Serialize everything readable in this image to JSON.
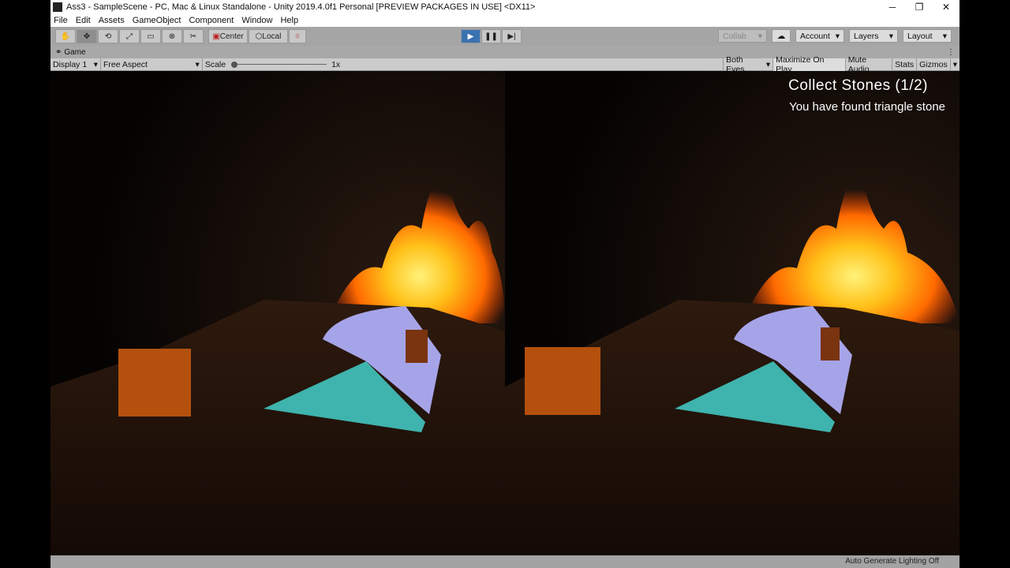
{
  "title": "Ass3 - SampleScene - PC, Mac & Linux Standalone - Unity 2019.4.0f1 Personal [PREVIEW PACKAGES IN USE] <DX11>",
  "menu": [
    "File",
    "Edit",
    "Assets",
    "GameObject",
    "Component",
    "Window",
    "Help"
  ],
  "toolbar": {
    "center": "Center",
    "local": "Local",
    "collab": "Collab",
    "account": "Account",
    "layers": "Layers",
    "layout": "Layout"
  },
  "game_tab": "Game",
  "gamebar": {
    "display": "Display 1",
    "aspect": "Free Aspect",
    "scale_label": "Scale",
    "scale_value": "1x",
    "eyes": "Both Eyes",
    "maximize": "Maximize On Play",
    "mute": "Mute Audio",
    "stats": "Stats",
    "gizmos": "Gizmos"
  },
  "hud": {
    "title": "Collect Stones (1/2)",
    "message": "You have found triangle stone"
  },
  "status": "Auto Generate Lighting Off"
}
